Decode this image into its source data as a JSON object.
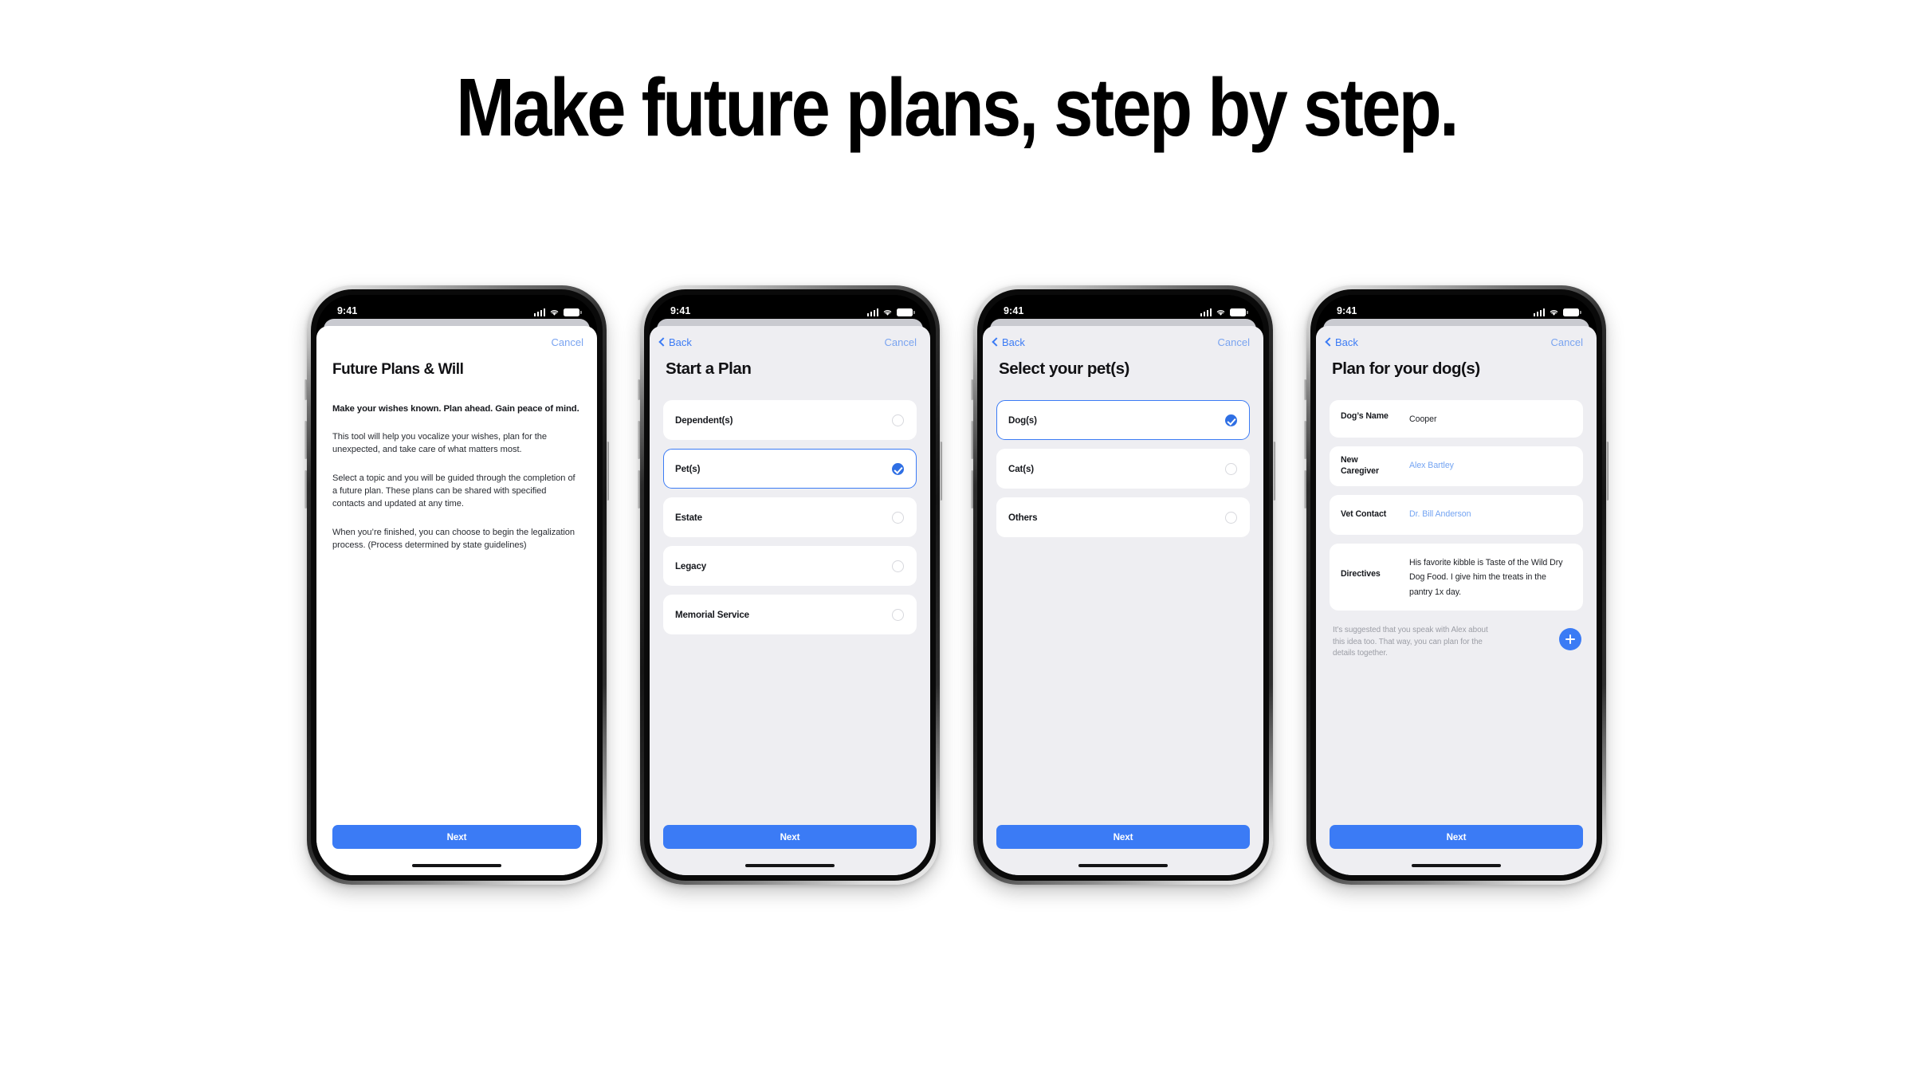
{
  "headline": "Make future plans, step by step.",
  "colors": {
    "accent_blue": "#3b7bf5",
    "link_blue": "#7aa4f0",
    "screen_bg_gray": "#eeeef2",
    "card_white": "#ffffff",
    "text_dark": "#16181d",
    "muted_gray": "#9b9da5"
  },
  "status_bar": {
    "time": "9:41",
    "signal_icon": "cellular-signal-icon",
    "wifi_icon": "wifi-icon",
    "battery_icon": "battery-icon"
  },
  "screens": [
    {
      "id": "intro",
      "nav": {
        "back_label": "",
        "cancel_label": "Cancel",
        "has_back": false
      },
      "title": "Future Plans & Will",
      "lead": "Make your wishes known. Plan ahead. Gain peace of mind.",
      "paragraphs": [
        "This tool will help you vocalize your wishes, plan for the unexpected, and take care of what matters most.",
        "Select a topic and you will be guided through the completion of a future plan. These plans can be shared with specified contacts and updated at any time.",
        "When you’re finished, you can choose to begin the legalization process. (Process determined by state guidelines)"
      ],
      "next_label": "Next"
    },
    {
      "id": "start-a-plan",
      "nav": {
        "back_label": "Back",
        "cancel_label": "Cancel",
        "has_back": true
      },
      "title": "Start a Plan",
      "options": [
        {
          "label": "Dependent(s)",
          "selected": false
        },
        {
          "label": "Pet(s)",
          "selected": true
        },
        {
          "label": "Estate",
          "selected": false
        },
        {
          "label": "Legacy",
          "selected": false
        },
        {
          "label": "Memorial Service",
          "selected": false
        }
      ],
      "next_label": "Next"
    },
    {
      "id": "select-pets",
      "nav": {
        "back_label": "Back",
        "cancel_label": "Cancel",
        "has_back": true
      },
      "title": "Select your pet(s)",
      "options": [
        {
          "label": "Dog(s)",
          "selected": true
        },
        {
          "label": "Cat(s)",
          "selected": false
        },
        {
          "label": "Others",
          "selected": false
        }
      ],
      "next_label": "Next"
    },
    {
      "id": "plan-for-dogs",
      "nav": {
        "back_label": "Back",
        "cancel_label": "Cancel",
        "has_back": true
      },
      "title": "Plan for your dog(s)",
      "fields": [
        {
          "label": "Dog’s Name",
          "value": "Cooper",
          "style": "input",
          "multiline": false
        },
        {
          "label": "New Caregiver",
          "value": "Alex Bartley",
          "style": "link",
          "multiline": false
        },
        {
          "label": "Vet Contact",
          "value": "Dr. Bill Anderson",
          "style": "link",
          "multiline": false
        },
        {
          "label": "Directives",
          "value": "His favorite kibble is Taste of the Wild Dry Dog Food. I give him the treats in the pantry 1x day.",
          "style": "input",
          "multiline": true
        }
      ],
      "suggestion": "It’s suggested that you speak with Alex about this idea too. That way, you can plan for the details together.",
      "add_button_icon": "plus-icon",
      "next_label": "Next"
    }
  ]
}
